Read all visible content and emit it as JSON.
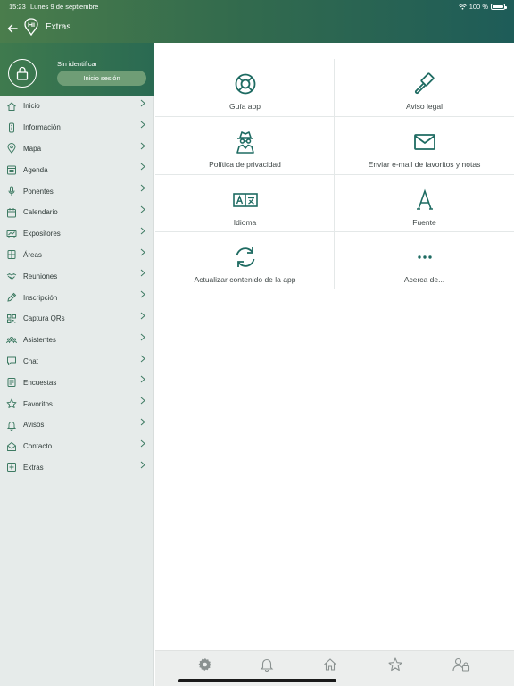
{
  "status_bar": {
    "time": "15:23",
    "date": "Lunes 9 de septiembre",
    "battery": "100 %"
  },
  "header": {
    "title": "Extras"
  },
  "user": {
    "status": "Sin identificar",
    "login_label": "Inicio sesión"
  },
  "sidebar": {
    "items": [
      {
        "label": "Inicio",
        "icon": "home-icon"
      },
      {
        "label": "Información",
        "icon": "info-icon"
      },
      {
        "label": "Mapa",
        "icon": "map-pin-icon"
      },
      {
        "label": "Agenda",
        "icon": "agenda-icon"
      },
      {
        "label": "Ponentes",
        "icon": "microphone-icon"
      },
      {
        "label": "Calendario",
        "icon": "calendar-icon"
      },
      {
        "label": "Expositores",
        "icon": "exhibitors-icon"
      },
      {
        "label": "Áreas",
        "icon": "areas-icon"
      },
      {
        "label": "Reuniones",
        "icon": "handshake-icon"
      },
      {
        "label": "Inscripción",
        "icon": "pen-icon"
      },
      {
        "label": "Captura QRs",
        "icon": "qr-icon"
      },
      {
        "label": "Asistentes",
        "icon": "attendees-icon"
      },
      {
        "label": "Chat",
        "icon": "chat-icon"
      },
      {
        "label": "Encuestas",
        "icon": "survey-icon"
      },
      {
        "label": "Favoritos",
        "icon": "star-icon"
      },
      {
        "label": "Avisos",
        "icon": "bell-icon"
      },
      {
        "label": "Contacto",
        "icon": "envelope-open-icon"
      },
      {
        "label": "Extras",
        "icon": "plus-square-icon"
      }
    ]
  },
  "extras": {
    "items": [
      {
        "label": "Guía app",
        "icon": "lifebuoy-icon"
      },
      {
        "label": "Aviso legal",
        "icon": "gavel-icon"
      },
      {
        "label": "Política de privacidad",
        "icon": "spy-icon"
      },
      {
        "label": "Enviar e-mail de favoritos y notas",
        "icon": "envelope-icon"
      },
      {
        "label": "Idioma",
        "icon": "translate-icon"
      },
      {
        "label": "Fuente",
        "icon": "font-icon"
      },
      {
        "label": "Actualizar contenido de la app",
        "icon": "refresh-icon"
      },
      {
        "label": "Acerca de...",
        "icon": "ellipsis-icon"
      }
    ]
  },
  "tabbar": {
    "items": [
      {
        "icon": "gear-icon"
      },
      {
        "icon": "bell-icon"
      },
      {
        "icon": "home-icon"
      },
      {
        "icon": "star-icon"
      },
      {
        "icon": "user-lock-icon"
      }
    ]
  },
  "colors": {
    "accent": "#1e6b62",
    "header_start": "#4a7d4c",
    "header_end": "#1e5c58",
    "sidebar_bg": "#e6ebea"
  }
}
